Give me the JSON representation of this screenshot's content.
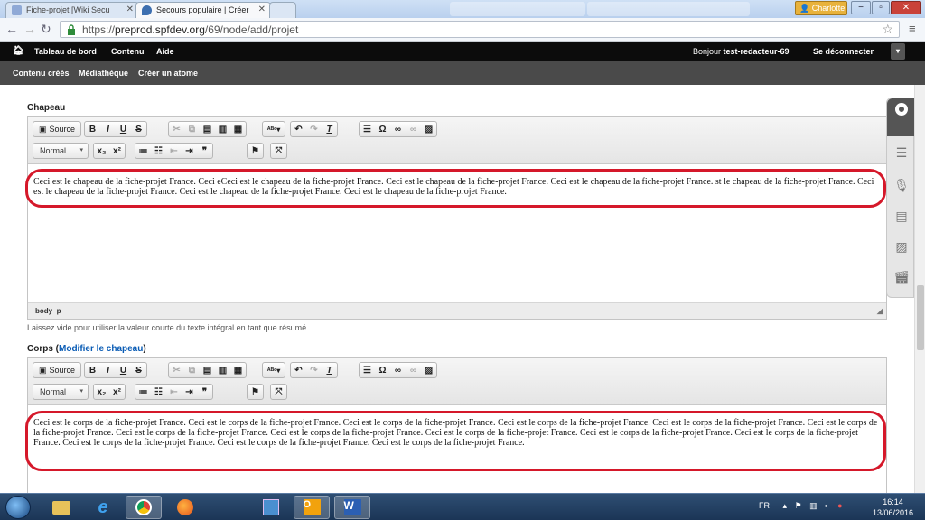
{
  "browser": {
    "tabs": [
      {
        "title": "Fiche-projet [Wiki Secu",
        "active": false
      },
      {
        "title": "Secours populaire | Créer",
        "active": true
      }
    ],
    "user_button": "Charlotte",
    "url_scheme": "https://",
    "url_host": "preprod.spfdev.org",
    "url_path": "/69/node/add/projet"
  },
  "toolbar": {
    "items": [
      "Tableau de bord",
      "Contenu",
      "Aide"
    ],
    "greeting_prefix": "Bonjour ",
    "username": "test-redacteur-69",
    "logout": "Se déconnecter"
  },
  "shortcuts": {
    "items": [
      "Contenu créés",
      "Médiathèque",
      "Créer un atome"
    ]
  },
  "editor_toolbar": {
    "source_label": "Source",
    "format_select": "Normal"
  },
  "chapeau": {
    "label": "Chapeau",
    "text": "Ceci est le chapeau de la fiche-projet France. Ceci eCeci est le chapeau de la fiche-projet France. Ceci est le chapeau de la fiche-projet France. Ceci est le chapeau de la fiche-projet France. st le chapeau de la fiche-projet France. Ceci est le chapeau de la fiche-projet France. Ceci est le chapeau de la fiche-projet France. Ceci est le chapeau de la fiche-projet France.",
    "path_body": "body",
    "path_p": "p",
    "hint": "Laissez vide pour utiliser la valeur courte du texte intégral en tant que résumé."
  },
  "corps": {
    "label": "Corps (",
    "link": "Modifier le chapeau",
    "label_end": ")",
    "text": "Ceci est le corps de la fiche-projet France. Ceci est le corps de la fiche-projet France. Ceci est le corps de la fiche-projet France. Ceci est le corps de la fiche-projet France. Ceci est le corps de la fiche-projet France. Ceci est le corps de la fiche-projet France. Ceci est le corps de la fiche-projet France. Ceci est le corps de la fiche-projet France. Ceci est le corps de la fiche-projet France. Ceci est le corps de la fiche-projet France. Ceci est le corps de la fiche-projet France. Ceci est le corps de la fiche-projet France. Ceci est le corps de la fiche-projet France. Ceci est le corps de la fiche-projet France."
  },
  "taskbar": {
    "language": "FR",
    "time": "16:14",
    "date": "13/06/2016"
  },
  "colors": {
    "highlight_ring": "#d5182a",
    "toolbar": "#0c0c0c",
    "shortcuts": "#4a4a4a",
    "link": "#0a5cb5"
  }
}
